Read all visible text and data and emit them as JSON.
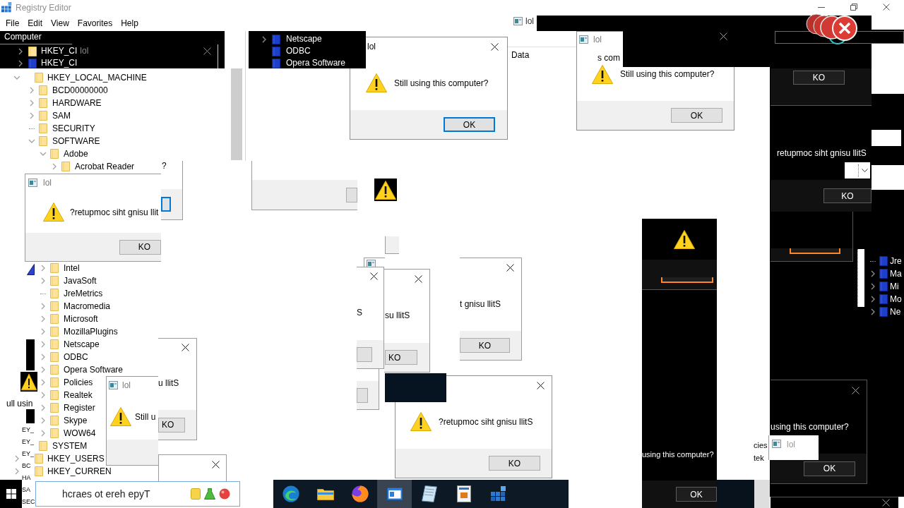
{
  "window": {
    "title": "Registry Editor",
    "menu": [
      "File",
      "Edit",
      "View",
      "Favorites",
      "Help"
    ]
  },
  "tree_fragment_top": {
    "header": "Computer",
    "rows": [
      {
        "label": "HKEY_CI",
        "expanded": false
      },
      {
        "label": "HKEY_CI",
        "expanded": false
      }
    ],
    "dialog_title": "lol"
  },
  "tree": [
    {
      "label": "HKEY_LOCAL_MACHINE",
      "expanded": true,
      "children": [
        {
          "label": "BCD00000000",
          "expanded": false
        },
        {
          "label": "HARDWARE",
          "expanded": false
        },
        {
          "label": "SAM",
          "expanded": false
        },
        {
          "label": "SECURITY",
          "leaf": true
        },
        {
          "label": "SOFTWARE",
          "expanded": true,
          "children": [
            {
              "label": "Adobe",
              "expanded": true,
              "children": [
                {
                  "label": "Acrobat Reader",
                  "expanded": false
                }
              ]
            },
            {
              "label": "Intel",
              "expanded": false
            },
            {
              "label": "JavaSoft",
              "expanded": false
            },
            {
              "label": "JreMetrics",
              "leaf": true
            },
            {
              "label": "Macromedia",
              "expanded": false
            },
            {
              "label": "Microsoft",
              "expanded": false
            },
            {
              "label": "MozillaPlugins",
              "expanded": false
            },
            {
              "label": "Netscape",
              "expanded": false
            },
            {
              "label": "ODBC",
              "expanded": false
            },
            {
              "label": "Opera Software",
              "expanded": false
            },
            {
              "label": "Policies",
              "expanded": false
            },
            {
              "label": "Realtek",
              "expanded": false
            },
            {
              "label": "Register",
              "expanded": false
            },
            {
              "label": "Skype",
              "expanded": false
            },
            {
              "label": "WOW64",
              "expanded": false
            }
          ]
        },
        {
          "label": "SYSTEM"
        }
      ]
    },
    {
      "label": "HKEY_USERS",
      "expanded": false
    },
    {
      "label": "HKEY_CURREN",
      "expanded": false
    }
  ],
  "tree_fragment_middle": {
    "rows": [
      {
        "label": "Netscape",
        "expanded": false
      },
      {
        "label": "ODBC"
      },
      {
        "label": "Opera Software"
      }
    ]
  },
  "list_header": {
    "column": "Data"
  },
  "title_fragments": [
    "lol",
    "lol"
  ],
  "text_fragments": [
    "s com",
    "ull usin"
  ],
  "dialogs": [
    {
      "kind": "light",
      "title": "lol",
      "close": true,
      "warning": true,
      "message": "Still using this computer?",
      "button": {
        "label": "OK",
        "focused": true
      }
    },
    {
      "kind": "light",
      "title": "lol",
      "close": false,
      "warning": true,
      "message": "Still using this computer?",
      "button": {
        "label": "OK",
        "focused": false
      }
    },
    {
      "kind": "dark",
      "close": true,
      "warning": false
    },
    {
      "kind": "dark",
      "close": false,
      "warning": false,
      "button": {
        "label": "KO",
        "focused": false
      }
    },
    {
      "kind": "light",
      "close": false,
      "warning": false,
      "message": "?",
      "button": {
        "focused": true
      }
    },
    {
      "kind": "light",
      "close": false,
      "warning": false,
      "button": {
        "focused": false
      }
    },
    {
      "kind": "light",
      "title": "lol",
      "close": false,
      "warning": true,
      "message": "?retupmoc siht gnisu llit",
      "button": {
        "label": "KO",
        "focused": false
      }
    },
    {
      "kind": "dark",
      "close": false,
      "warning": false,
      "message": "retupmoc siht gnisu llitS",
      "button": {
        "label": "KO",
        "focused": false
      }
    },
    {
      "kind": "dark",
      "close": false,
      "warning": true,
      "button": {
        "focused": true
      }
    },
    {
      "kind": "dark",
      "close": false,
      "warning": false,
      "button": {
        "focused": true
      }
    },
    {
      "kind": "light",
      "close": true,
      "warning": false,
      "message": "S",
      "button": {
        "focused": false
      }
    },
    {
      "kind": "light",
      "close": true,
      "warning": false,
      "message": "su llitS",
      "button": {
        "label": "KO",
        "focused": false
      }
    },
    {
      "kind": "light",
      "close": true,
      "warning": false,
      "message": "t gnisu llitS",
      "button": {
        "label": "KO",
        "focused": false
      }
    },
    {
      "kind": "light",
      "title": "lol",
      "close": false,
      "warning": true,
      "message": "Still u"
    },
    {
      "kind": "light",
      "close": true,
      "warning": false,
      "message": "u llitS",
      "button": {
        "label": "KO",
        "focused": false
      }
    },
    {
      "kind": "light",
      "close": false,
      "warning": false,
      "button": {
        "focused": false
      }
    },
    {
      "kind": "light",
      "close": true,
      "warning": true,
      "message": "?retupmoc siht gnisu llitS",
      "button": {
        "label": "KO",
        "focused": false
      }
    },
    {
      "kind": "dark",
      "close": true,
      "warning": false,
      "message": "using this computer?",
      "button": {
        "label": "OK",
        "focused": false
      }
    },
    {
      "kind": "light",
      "close": true,
      "warning": false
    },
    {
      "kind": "dark",
      "close": false,
      "warning": false,
      "message": "using this computer?",
      "button": {
        "label": "OK",
        "focused": false
      }
    },
    {
      "kind": "dark",
      "close": true,
      "warning": false
    }
  ],
  "tree_fragment_right": {
    "rows": [
      {
        "label": "Jre",
        "leaf": true
      },
      {
        "label": "Ma",
        "expanded": false
      },
      {
        "label": "Mi",
        "expanded": false
      },
      {
        "label": "Mo",
        "expanded": false
      },
      {
        "label": "Ne",
        "expanded": false
      }
    ]
  },
  "tree_fragment_left": [
    "EY_",
    "EY_",
    "EY_",
    "BC",
    "HA",
    "SA",
    "SEC"
  ],
  "list_fragment": [
    "cies",
    "tek"
  ],
  "taskbar": {
    "search": {
      "placeholder": "hcraes ot ereh epyT"
    },
    "apps": [
      {
        "selected": false
      },
      {
        "selected": false
      },
      {
        "selected": false
      },
      {
        "selected": true
      },
      {
        "selected": false
      },
      {
        "selected": false
      },
      {
        "selected": false
      }
    ]
  }
}
